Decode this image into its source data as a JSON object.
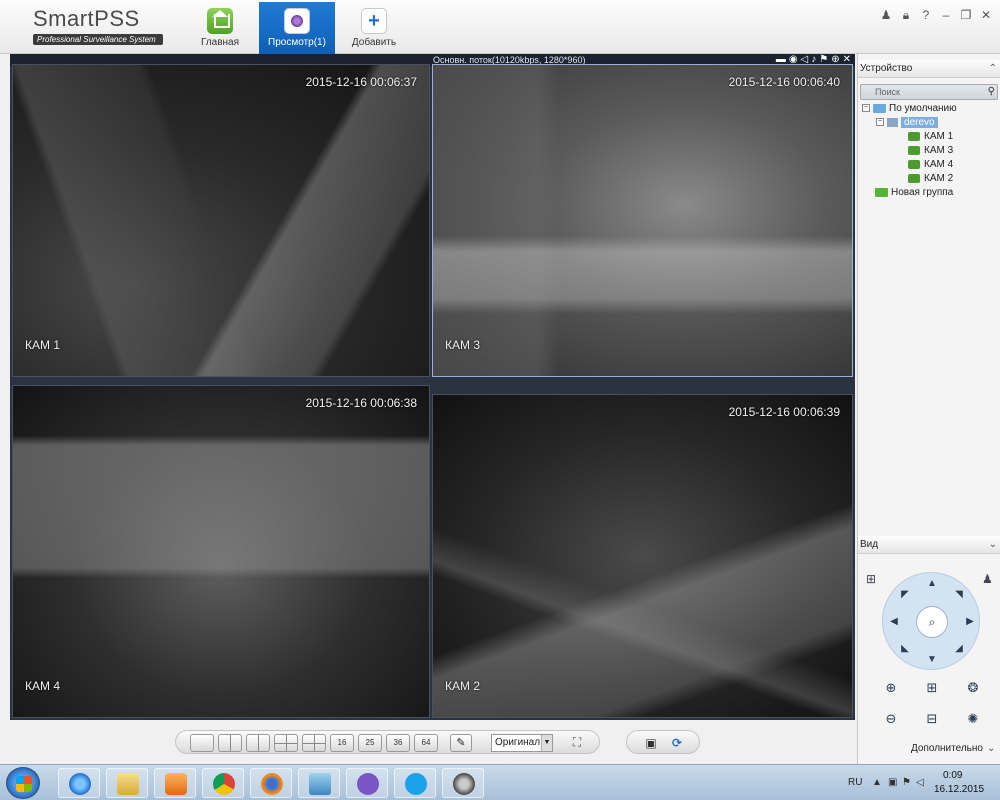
{
  "app": {
    "logo_title": "SmartPSS",
    "logo_subtitle": "Professional Surveillance System",
    "tabs": [
      {
        "label": "Главная",
        "icon": "home-icon"
      },
      {
        "label": "Просмотр(1)",
        "icon": "live-view-icon"
      },
      {
        "label": "Добавить",
        "icon": "add-icon"
      }
    ],
    "window_controls": [
      "user-icon",
      "lock-icon",
      "help-icon",
      "minimize-icon",
      "restore-icon",
      "close-icon"
    ]
  },
  "video": {
    "stream_info": "Основн. поток(10120kbps, 1280*960)",
    "stream_tools": [
      "▬",
      "◉",
      "◁",
      "♪",
      "⚑",
      "⊕",
      "✕"
    ],
    "cameras": [
      {
        "label": "КАМ 1",
        "timestamp": "2015-12-16 00:06:37"
      },
      {
        "label": "КАМ 3",
        "timestamp": "2015-12-16 00:06:40"
      },
      {
        "label": "КАМ 4",
        "timestamp": "2015-12-16 00:06:38"
      },
      {
        "label": "КАМ 2",
        "timestamp": "2015-12-16 00:06:39"
      }
    ]
  },
  "toolbar": {
    "layouts": [
      "",
      "",
      "",
      "",
      "",
      "16",
      "25",
      "36",
      "64"
    ],
    "stream_select": "Оригинал",
    "fullscreen": "⛶",
    "save_icon": "▣",
    "refresh_icon": "⟳"
  },
  "devices": {
    "header": "Устройство",
    "search_placeholder": "Поиск",
    "tree": [
      {
        "label": "По умолчанию"
      },
      {
        "label": "derevo"
      },
      {
        "label": "КАМ 1"
      },
      {
        "label": "КАМ 3"
      },
      {
        "label": "КАМ 4"
      },
      {
        "label": "КАМ 2"
      },
      {
        "label": "Новая группа"
      }
    ]
  },
  "view_panel": {
    "header": "Вид",
    "more_label": "Дополнительно"
  },
  "taskbar": {
    "lang": "RU",
    "time": "0:09",
    "date": "16.12.2015"
  },
  "colors": {
    "accent_tab": "#1f7bd8",
    "video_bg": "#2b3240",
    "tree_highlight": "#7eaee0"
  }
}
